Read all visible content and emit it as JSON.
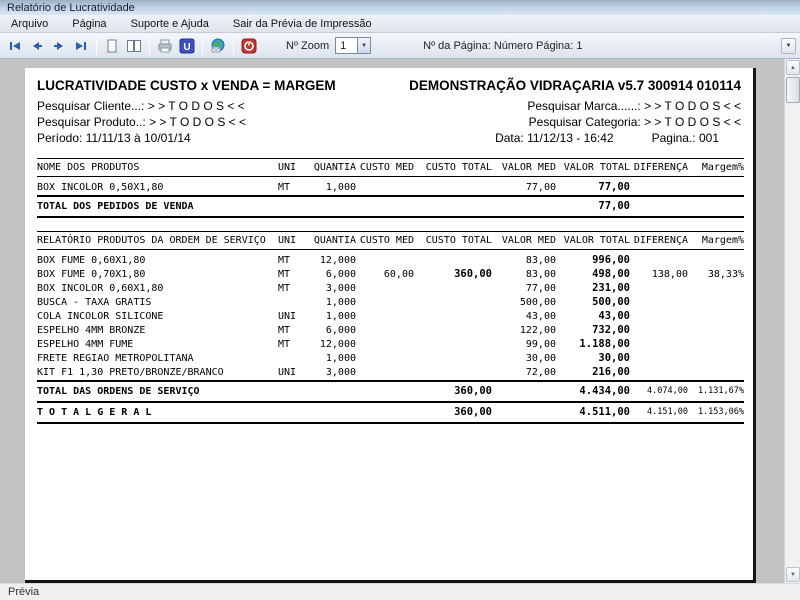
{
  "window": {
    "title": "Relatório de Lucratividade"
  },
  "menu": {
    "items": [
      "Arquivo",
      "Página",
      "Suporte e Ajuda",
      "Sair da Prévia de Impressão"
    ]
  },
  "toolbar": {
    "zoom_label": "Nº Zoom",
    "zoom_value": "1",
    "page_info": "Nº da Página: Número Página: 1",
    "icons": [
      "first-page",
      "previous-page",
      "next-page",
      "last-page",
      "single-page-view",
      "two-page-view",
      "print",
      "print-options",
      "export-web",
      "close-preview",
      "toolbar-overflow"
    ]
  },
  "statusbar": {
    "text": "Prévia"
  },
  "colors": {
    "titlebar_blue": "#c3d5e9",
    "arrow_blue": "#2b5fb0",
    "print_options_blue": "#3c50c0",
    "globe_green": "#3fae6a",
    "power_red": "#c63535",
    "workspace_gray": "#c2c2c2"
  },
  "report": {
    "title_left": "LUCRATIVIDADE CUSTO x VENDA = MARGEM",
    "title_right": "DEMONSTRAÇÃO VIDRAÇARIA v5.7 300914 010114",
    "filter_cliente_label": "Pesquisar Cliente...:",
    "filter_cliente_value": "> >  T O D O S  < <",
    "filter_marca_label": "Pesquisar Marca......:",
    "filter_marca_value": "> >  T O D O S  < <",
    "filter_produto_label": "Pesquisar Produto..:",
    "filter_produto_value": "> >  T O D O S  < <",
    "filter_categoria_label": "Pesquisar Categoria:",
    "filter_categoria_value": "> >  T O D O S  < <",
    "periodo": "Período: 11/11/13 à 10/01/14",
    "data_hora": "Data: 11/12/13 - 16:42",
    "pagina": "Pagina.: 001",
    "pedidos": {
      "headers": [
        "NOME DOS PRODUTOS",
        "UNI",
        "QUANTIA",
        "CUSTO MED",
        "CUSTO TOTAL",
        "VALOR MED",
        "VALOR TOTAL",
        "DIFERENÇA",
        "Margem%"
      ],
      "rows": [
        [
          "BOX INCOLOR 0,50X1,80",
          "MT",
          "1,000",
          "",
          "",
          "77,00",
          "77,00",
          "",
          ""
        ],
        {
          "cells": [
            "TOTAL DOS PEDIDOS DE VENDA",
            "",
            "",
            "",
            "",
            "",
            "77,00",
            "",
            ""
          ],
          "total": true
        }
      ]
    },
    "ordens": {
      "headers": [
        "RELATÓRIO PRODUTOS DA ORDEM DE SERVIÇO",
        "UNI",
        "QUANTIA",
        "CUSTO MED",
        "CUSTO TOTAL",
        "VALOR MED",
        "VALOR TOTAL",
        "DIFERENÇA",
        "Margem%"
      ],
      "rows": [
        [
          "BOX FUME 0,60X1,80",
          "MT",
          "12,000",
          "",
          "",
          "83,00",
          "996,00",
          "",
          ""
        ],
        [
          "BOX FUME 0,70X1,80",
          "MT",
          "6,000",
          "60,00",
          "360,00",
          "83,00",
          "498,00",
          "138,00",
          "38,33%"
        ],
        [
          "BOX INCOLOR 0,60X1,80",
          "MT",
          "3,000",
          "",
          "",
          "77,00",
          "231,00",
          "",
          ""
        ],
        [
          "BUSCA - TAXA GRATIS",
          "",
          "1,000",
          "",
          "",
          "500,00",
          "500,00",
          "",
          ""
        ],
        [
          "COLA INCOLOR SILICONE",
          "UNI",
          "1,000",
          "",
          "",
          "43,00",
          "43,00",
          "",
          ""
        ],
        [
          "ESPELHO 4MM BRONZE",
          "MT",
          "6,000",
          "",
          "",
          "122,00",
          "732,00",
          "",
          ""
        ],
        [
          "ESPELHO 4MM FUME",
          "MT",
          "12,000",
          "",
          "",
          "99,00",
          "1.188,00",
          "",
          ""
        ],
        [
          "FRETE REGIAO METROPOLITANA",
          "",
          "1,000",
          "",
          "",
          "30,00",
          "30,00",
          "",
          ""
        ],
        [
          "KIT F1 1,30 PRETO/BRONZE/BRANCO",
          "UNI",
          "3,000",
          "",
          "",
          "72,00",
          "216,00",
          "",
          ""
        ],
        {
          "cells": [
            "TOTAL DAS ORDENS DE SERVIÇO",
            "",
            "",
            "",
            "360,00",
            "",
            "4.434,00",
            "4.074,00",
            "1.131,67%"
          ],
          "total": true
        },
        {
          "cells": [
            "T O T A L   G E R A L",
            "",
            "",
            "",
            "360,00",
            "",
            "4.511,00",
            "4.151,00",
            "1.153,06%"
          ],
          "total": true
        }
      ]
    }
  }
}
